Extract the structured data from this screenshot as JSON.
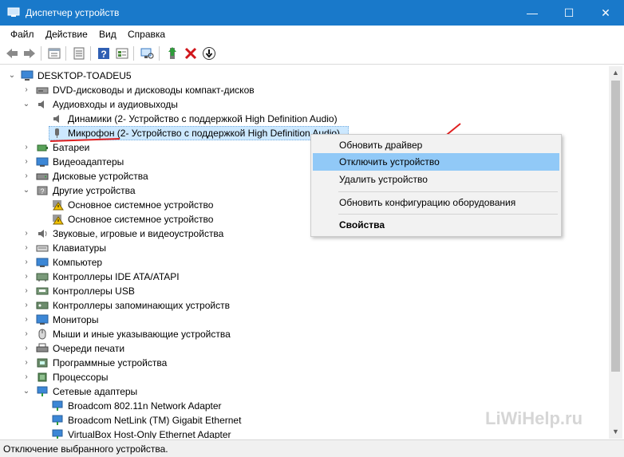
{
  "window": {
    "title": "Диспетчер устройств",
    "minimize": "—",
    "maximize": "☐",
    "close": "✕",
    "title_bar_color": "#1979ca"
  },
  "menu": [
    "Файл",
    "Действие",
    "Вид",
    "Справка"
  ],
  "tree": {
    "root": "DESKTOP-TOADEU5",
    "rows": [
      "DVD-дисководы и дисководы компакт-дисков",
      "Аудиовходы и аудиовыходы",
      "Динамики (2- Устройство с поддержкой High Definition Audio)",
      "Микрофон (2- Устройство с поддержкой High Definition Audio)",
      "Батареи",
      "Видеоадаптеры",
      "Дисковые устройства",
      "Другие устройства",
      "Основное системное устройство",
      "Основное системное устройство",
      "Звуковые, игровые и видеоустройства",
      "Клавиатуры",
      "Компьютер",
      "Контроллеры IDE ATA/ATAPI",
      "Контроллеры USB",
      "Контроллеры запоминающих устройств",
      "Мониторы",
      "Мыши и иные указывающие устройства",
      "Очереди печати",
      "Программные устройства",
      "Процессоры",
      "Сетевые адаптеры",
      "Broadcom 802.11n Network Adapter",
      "Broadcom NetLink (TM) Gigabit Ethernet",
      "VirtualBox Host-Only Ethernet Adapter"
    ]
  },
  "context_menu": {
    "items": [
      "Обновить драйвер",
      "Отключить устройство",
      "Удалить устройство",
      "Обновить конфигурацию оборудования",
      "Свойства"
    ],
    "highlighted": "Отключить устройство",
    "highlight_color": "#91c9f7"
  },
  "status": "Отключение выбранного устройства.",
  "watermark": "LiWiHelp.ru",
  "annotation_color": "#e02020"
}
